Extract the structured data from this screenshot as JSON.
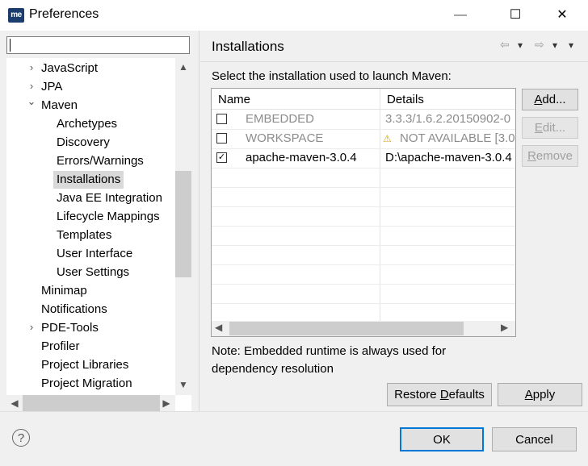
{
  "window": {
    "logo_text": "me",
    "title": "Preferences",
    "minimize_glyph": "—",
    "maximize_glyph": "☐",
    "close_glyph": "✕"
  },
  "sidebar": {
    "filter_placeholder": "",
    "items": [
      {
        "label": "JavaScript",
        "arrow": "›"
      },
      {
        "label": "JPA",
        "arrow": "›"
      },
      {
        "label": "Maven",
        "arrow": "⌄"
      },
      {
        "label": "Archetypes"
      },
      {
        "label": "Discovery"
      },
      {
        "label": "Errors/Warnings"
      },
      {
        "label": "Installations",
        "selected": true
      },
      {
        "label": "Java EE Integration"
      },
      {
        "label": "Lifecycle Mappings"
      },
      {
        "label": "Templates"
      },
      {
        "label": "User Interface"
      },
      {
        "label": "User Settings"
      },
      {
        "label": "Minimap"
      },
      {
        "label": "Notifications"
      },
      {
        "label": "PDE-Tools",
        "arrow": "›"
      },
      {
        "label": "Profiler"
      },
      {
        "label": "Project Libraries"
      },
      {
        "label": "Project Migration"
      }
    ]
  },
  "page": {
    "title": "Installations",
    "nav_back": "⇦",
    "nav_fwd": "⇨",
    "dropdown": "▾",
    "instructions": "Select the installation used to launch Maven:",
    "table": {
      "columns": [
        "Name",
        "Details"
      ],
      "rows": [
        {
          "checked": false,
          "name": "EMBEDDED",
          "details": "3.3.3/1.6.2.20150902-0",
          "muted": true,
          "warning": false
        },
        {
          "checked": false,
          "name": "WORKSPACE",
          "details": "NOT AVAILABLE [3.0",
          "muted": true,
          "warning": true
        },
        {
          "checked": true,
          "name": "apache-maven-3.0.4",
          "details": "D:\\apache-maven-3.0.4",
          "muted": false,
          "warning": false
        }
      ]
    },
    "buttons": {
      "add": {
        "pre": "",
        "key": "A",
        "post": "dd..."
      },
      "edit": {
        "pre": "",
        "key": "E",
        "post": "dit..."
      },
      "remove": {
        "pre": "",
        "key": "R",
        "post": "emove"
      },
      "restore": {
        "pre": "Restore ",
        "key": "D",
        "post": "efaults"
      },
      "apply": {
        "pre": "",
        "key": "A",
        "post": "pply"
      }
    },
    "note": "Note: Embedded runtime is always used for dependency resolution"
  },
  "footer": {
    "help_glyph": "?",
    "ok": "OK",
    "cancel": "Cancel"
  }
}
